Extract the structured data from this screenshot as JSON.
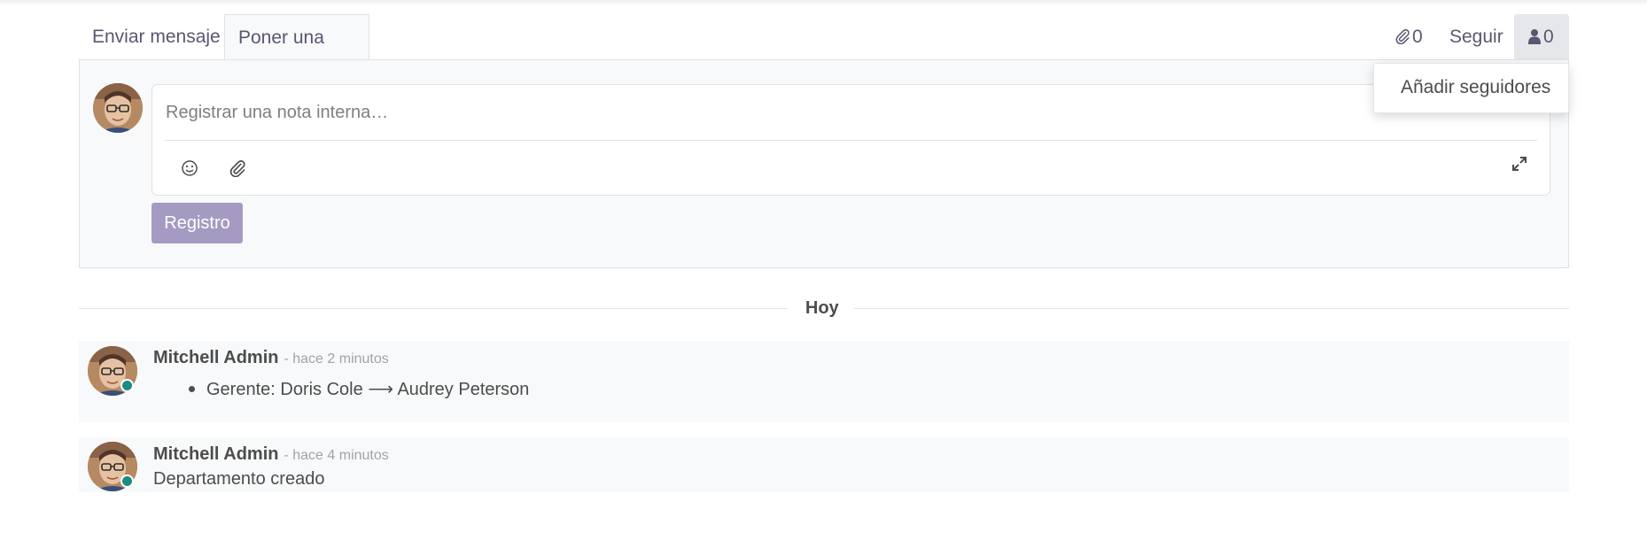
{
  "tabs": [
    {
      "label": "Enviar mensaje"
    },
    {
      "label": "Poner una nota"
    }
  ],
  "topbar": {
    "attachments_count": "0",
    "follow_label": "Seguir",
    "followers_count": "0"
  },
  "dropdown": {
    "add_followers_label": "Añadir seguidores"
  },
  "composer": {
    "placeholder": "Registrar una nota interna…",
    "submit_label": "Registro"
  },
  "separator": {
    "label": "Hoy"
  },
  "messages": [
    {
      "author": "Mitchell Admin",
      "date": "- hace 2 minutos",
      "tracking": {
        "field": "Gerente:",
        "old": "Doris Cole",
        "arrow": "⟶",
        "new": "Audrey Peterson"
      }
    },
    {
      "author": "Mitchell Admin",
      "date": "- hace 4 minutos",
      "body": "Departamento creado"
    }
  ],
  "colors": {
    "accent": "#a59bc2",
    "presence": "#1b8c85",
    "panel_bg": "#f8f9fa",
    "icon": "#5a5670"
  },
  "icons": [
    "paperclip-icon",
    "user-icon",
    "smiley-icon",
    "expand-icon",
    "arrow-icon"
  ]
}
